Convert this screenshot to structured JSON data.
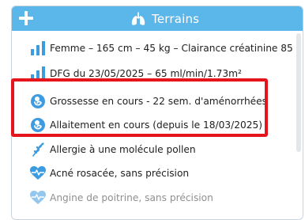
{
  "header": {
    "title": "Terrains",
    "add_icon": "plus-icon",
    "title_icon": "lungs-icon",
    "bg_color": "#5bb6e9"
  },
  "items": [
    {
      "icon": "bar-chart-icon",
      "label": "Femme – 165 cm – 45 kg – Clairance créatinine 85"
    },
    {
      "icon": "bar-chart-icon",
      "label": "DFG du 23/05/2025 – 65 ml/min/1.73m²"
    },
    {
      "icon": "fetus-icon",
      "label": "Grossesse en cours - 22 sem. d'aménorrhées"
    },
    {
      "icon": "breastfeeding-icon",
      "label": "Allaitement en cours (depuis le 18/03/2025)"
    },
    {
      "icon": "pollen-icon",
      "label": "Allergie à une molécule pollen"
    },
    {
      "icon": "heart-pulse-icon",
      "label": "Acné rosacée, sans précision"
    },
    {
      "icon": "heart-pulse-icon",
      "label": "Angine de poitrine, sans précision"
    }
  ],
  "colors": {
    "accent": "#3d9be0",
    "highlight": "#e6141c"
  }
}
